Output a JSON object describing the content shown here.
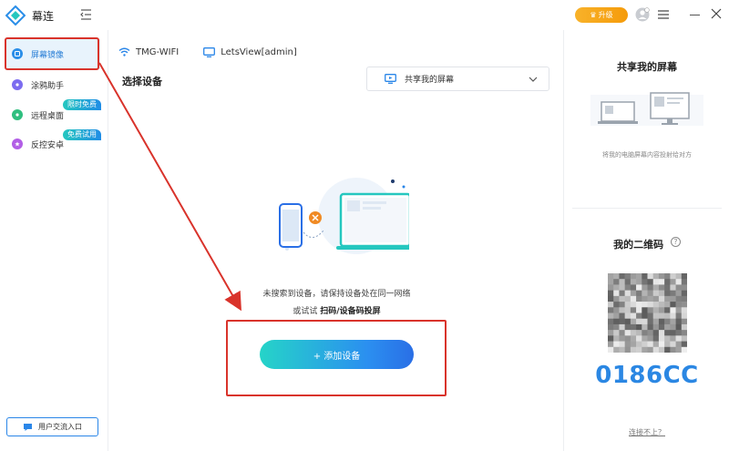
{
  "app": {
    "title": "幕连"
  },
  "titlebar": {
    "upgrade_label": "升级"
  },
  "sidebar": {
    "items": [
      {
        "label": "屏幕镜像",
        "badge": ""
      },
      {
        "label": "涂鸦助手",
        "badge": ""
      },
      {
        "label": "远程桌面",
        "badge": "限时免费"
      },
      {
        "label": "反控安卓",
        "badge": "免费试用"
      }
    ],
    "feedback_label": "用户交流入口"
  },
  "main": {
    "wifi_name": "TMG-WIFI",
    "device_name": "LetsView[admin]",
    "select_device_title": "选择设备",
    "share_select_label": "共享我的屏幕",
    "hint_line1": "未搜索到设备，请保持设备处在同一网络",
    "hint_line2_prefix": "或试试 ",
    "hint_line2_bold": "扫码/设备码投屏",
    "add_device_label": "+ 添加设备"
  },
  "right_panel": {
    "share_title": "共享我的屏幕",
    "share_desc": "将我的电脑屏幕内容投射给对方",
    "qr_title": "我的二维码",
    "device_code": "0186CC",
    "cant_connect": "连接不上？"
  },
  "colors": {
    "accent": "#2b87e3",
    "highlight_red": "#d9332b",
    "upgrade_orange": "#f5a31a",
    "badge_gradient_start": "#25c7bf",
    "badge_gradient_end": "#1f8ce6"
  }
}
